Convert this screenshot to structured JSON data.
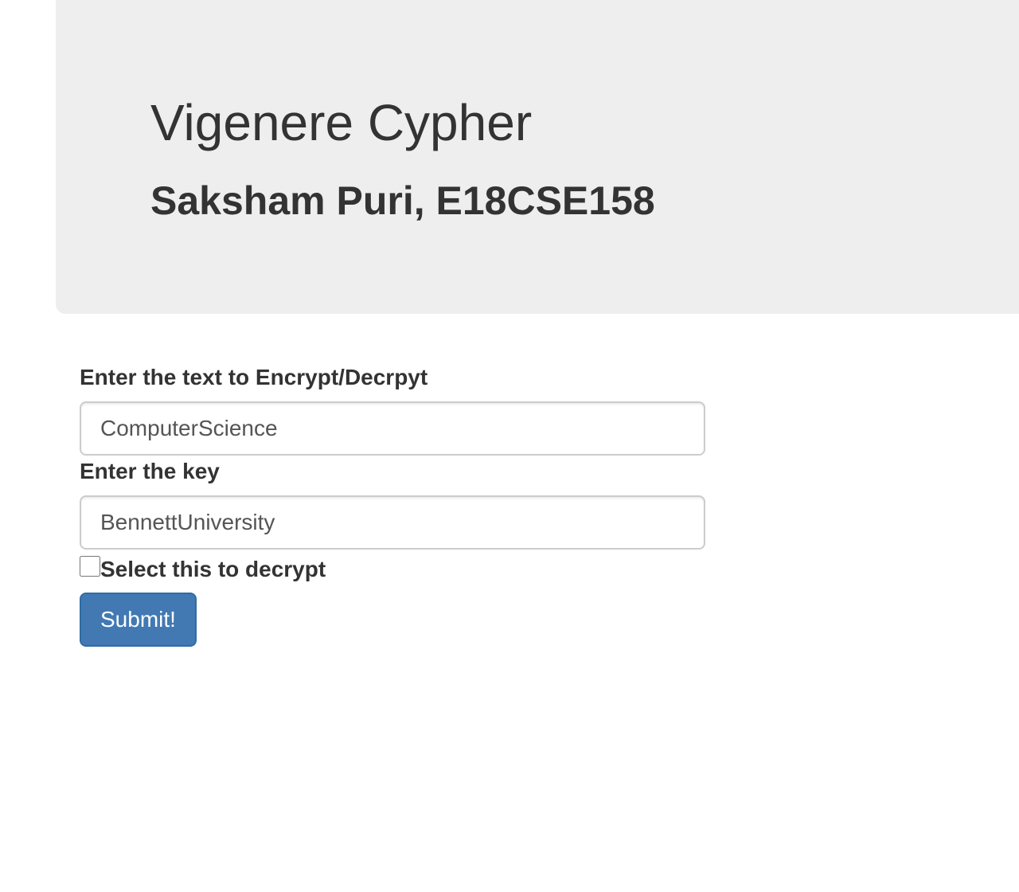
{
  "header": {
    "title": "Vigenere Cypher",
    "subtitle": "Saksham Puri, E18CSE158"
  },
  "form": {
    "text_label": "Enter the text to Encrypt/Decrpyt",
    "text_value": "ComputerScience",
    "key_label": "Enter the key",
    "key_value": "BennettUniversity",
    "decrypt_checkbox_label": "Select this to decrypt",
    "decrypt_checked": false,
    "submit_label": "Submit!"
  },
  "colors": {
    "jumbotron_bg": "#eeeeee",
    "button_bg": "#4279b3",
    "text": "#333333"
  }
}
